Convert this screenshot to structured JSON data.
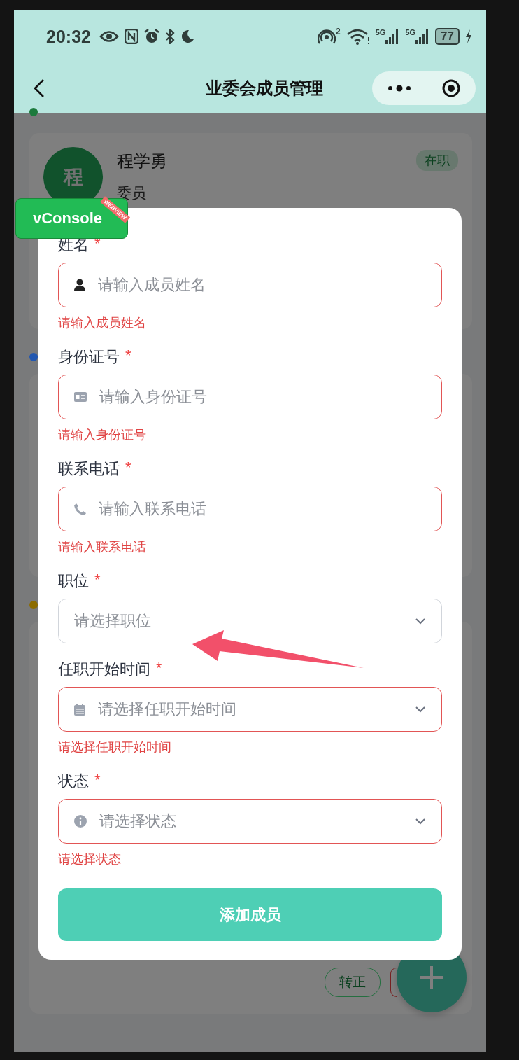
{
  "status_bar": {
    "time": "20:32",
    "hotspot_count": "2",
    "networks": [
      "5G",
      "5G"
    ],
    "battery": "77"
  },
  "nav": {
    "title": "业委会成员管理"
  },
  "groups": [
    {
      "color": "#1c7a3c",
      "members": [
        {
          "avatar": "程",
          "name": "程学勇",
          "role": "委员",
          "status": "在职"
        }
      ]
    },
    {
      "color": "#2358b0"
    },
    {
      "color": "#8c6c00",
      "actions": [
        "转正"
      ]
    }
  ],
  "dialog": {
    "fields": [
      {
        "kind": "input",
        "label": "姓名",
        "required_mark": "*",
        "placeholder": "请输入成员姓名",
        "error": "请输入成员姓名"
      },
      {
        "kind": "input",
        "label": "身份证号",
        "required_mark": "*",
        "placeholder": "请输入身份证号",
        "error": "请输入身份证号"
      },
      {
        "kind": "input",
        "label": "联系电话",
        "required_mark": "*",
        "placeholder": "请输入联系电话",
        "error": "请输入联系电话"
      },
      {
        "kind": "select",
        "label": "职位",
        "required_mark": "*",
        "placeholder": "请选择职位"
      },
      {
        "kind": "select",
        "label": "任职开始时间",
        "required_mark": "*",
        "placeholder": "请选择任职开始时间",
        "error": "请选择任职开始时间"
      },
      {
        "kind": "select",
        "label": "状态",
        "required_mark": "*",
        "placeholder": "请选择状态",
        "error": "请选择状态"
      }
    ],
    "submit": "添加成员"
  },
  "vconsole": {
    "label": "vConsole",
    "ribbon": "WEBVIEW"
  }
}
